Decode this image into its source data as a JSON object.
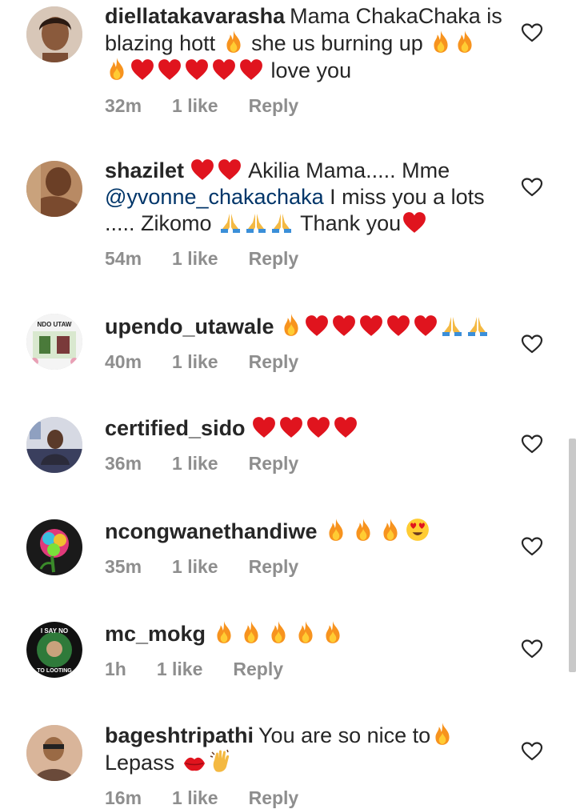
{
  "comments": [
    {
      "username": "diellatakavarasha",
      "text_before": "Mama ChakaChaka is blazing hott",
      "text_mid": "she us burning up",
      "text_end": "love you",
      "time": "32m",
      "likes": "1 like",
      "reply": "Reply"
    },
    {
      "username": "shazilet",
      "text_a": "Akilia Mama..... Mme",
      "mention": "@yvonne_chakachaka",
      "text_b": "I miss you a lots ..... Zikomo",
      "text_c": "Thank you",
      "time": "54m",
      "likes": "1 like",
      "reply": "Reply"
    },
    {
      "username": "upendo_utawale",
      "avatar_text": "NDO UTAW",
      "time": "40m",
      "likes": "1 like",
      "reply": "Reply"
    },
    {
      "username": "certified_sido",
      "time": "36m",
      "likes": "1 like",
      "reply": "Reply"
    },
    {
      "username": "ncongwanethandiwe",
      "time": "35m",
      "likes": "1 like",
      "reply": "Reply"
    },
    {
      "username": "mc_mokg",
      "avatar_text_top": "I SAY NO",
      "avatar_text_bottom": "TO LOOTING",
      "time": "1h",
      "likes": "1 like",
      "reply": "Reply"
    },
    {
      "username": "bageshtripathi",
      "text_a": "You are so nice to",
      "text_b": "Lepass",
      "time": "16m",
      "likes": "1 like",
      "reply": "Reply"
    }
  ],
  "icons": {
    "like": "heart-outline-icon",
    "emoji_fire": "fire-emoji",
    "emoji_heart": "red-heart-emoji",
    "emoji_pray": "folded-hands-emoji",
    "emoji_heart_eyes": "heart-eyes-emoji",
    "emoji_lips": "kiss-mark-emoji",
    "emoji_wave": "waving-hand-emoji"
  },
  "colors": {
    "text": "#262626",
    "meta": "#8e8e8e",
    "mention": "#003569",
    "heart": "#e0141e",
    "fire": "#f7931e"
  }
}
